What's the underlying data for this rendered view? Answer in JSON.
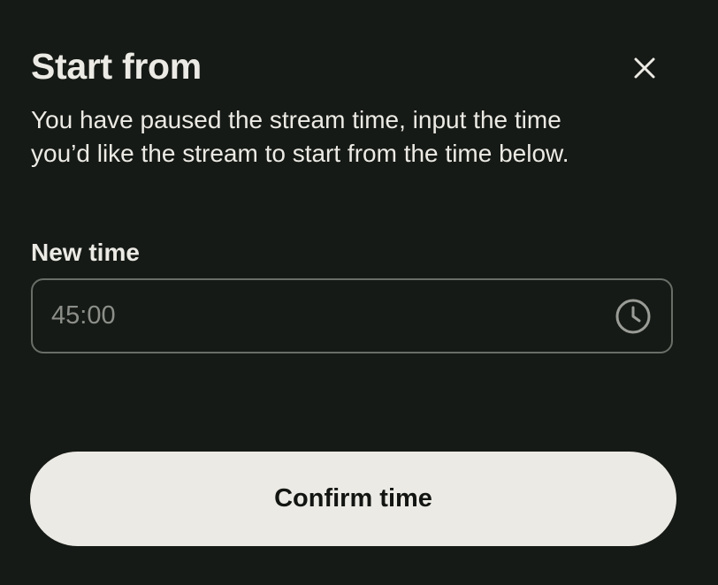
{
  "dialog": {
    "title": "Start from",
    "description": "You have paused the stream time, input the time you’d like the stream to start from the time below.",
    "close_icon": "close-icon"
  },
  "time_field": {
    "label": "New time",
    "value": "",
    "placeholder": "45:00",
    "icon": "clock-icon"
  },
  "confirm_button": {
    "label": "Confirm time"
  },
  "colors": {
    "background": "#161a16",
    "text": "#eceae4",
    "field_border": "#6a6e68",
    "placeholder": "#8c8f89",
    "button_background": "#eceae4",
    "button_text": "#121512"
  }
}
